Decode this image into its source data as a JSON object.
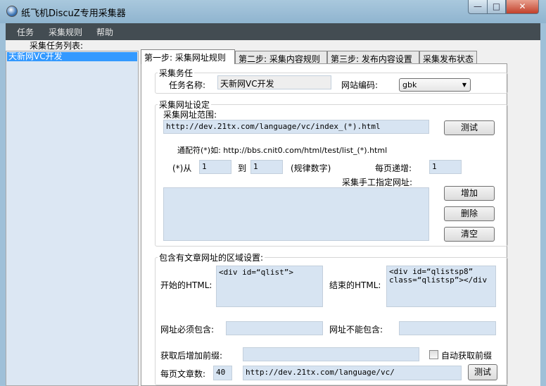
{
  "window": {
    "title": "纸飞机DiscuZ专用采集器",
    "min": "—",
    "max": "□",
    "close": "✕"
  },
  "menu": [
    "任务",
    "采集规则",
    "帮助"
  ],
  "sidebar": {
    "label": "采集任务列表:",
    "items": [
      "天新网VC开发"
    ]
  },
  "tabs": [
    "第一步: 采集网址规则",
    "第二步: 采集内容规则",
    "第三步: 发布内容设置",
    "采集发布状态"
  ],
  "task": {
    "group": "采集务任",
    "name_label": "任务名称:",
    "name_value": "天新网VC开发",
    "encoding_label": "网站编码:",
    "encoding_value": "gbk"
  },
  "url": {
    "group": "采集网址设定",
    "range_label": "采集网址范围:",
    "range_value": "http://dev.21tx.com/language/vc/index_(*).html",
    "test": "测试",
    "wildcard": "通配符(*)如: http://bbs.cnit0.com/html/test/list_(*).html",
    "from_label": "(*)从",
    "from_value": "1",
    "to_label": "到",
    "to_value": "1",
    "rule_note": "(规律数字)",
    "step_label": "每页递增:",
    "step_value": "1",
    "manual_label": "采集手工指定网址:",
    "manual_value": "",
    "add": "增加",
    "delete": "删除",
    "clear": "清空"
  },
  "region": {
    "group": "包含有文章网址的区域设置:",
    "start_label": "开始的HTML:",
    "start_value": "<div id=“qlist”>",
    "end_label": "结束的HTML:",
    "end_value": "<div id=“qlistsp8” class=“qlistsp”></div",
    "must_label": "网址必须包含:",
    "must_value": "",
    "not_label": "网址不能包含:",
    "not_value": "",
    "prefix_label": "获取后增加前缀:",
    "prefix_value": "",
    "auto_prefix": "自动获取前缀",
    "per_page_label": "每页文章数:",
    "per_page_value": "40",
    "test_url": "http://dev.21tx.com/language/vc/",
    "test": "测试"
  }
}
